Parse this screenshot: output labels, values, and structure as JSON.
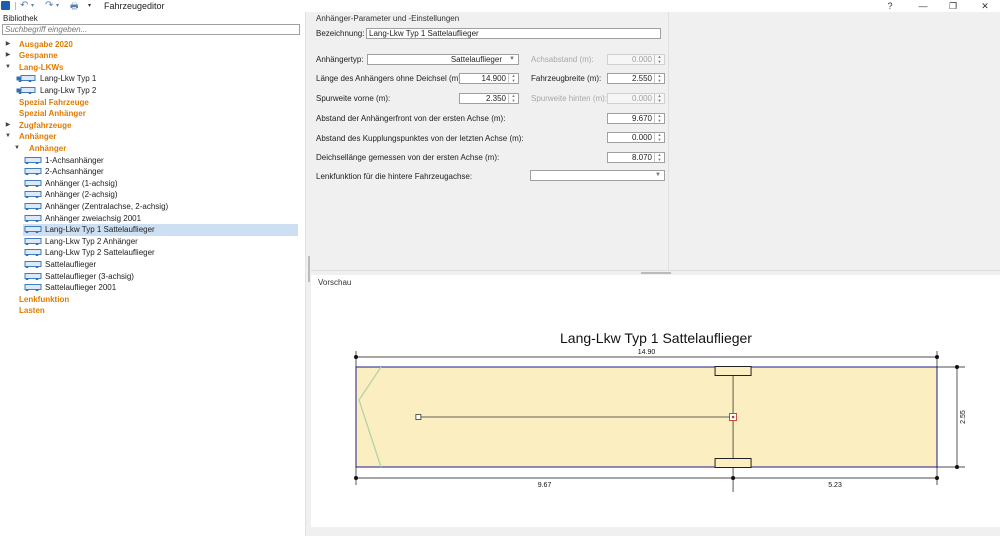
{
  "window": {
    "title": "Fahrzeugeditor",
    "help": "?",
    "minimize": "—",
    "maximize": "❐",
    "close": "✕"
  },
  "quick_access": {
    "undo_icon": "↶",
    "redo_icon": "↷",
    "print_icon": "🖶",
    "dropdown_icon": "▾"
  },
  "library": {
    "header": "Bibliothek",
    "search_placeholder": "Suchbegriff eingeben...",
    "tree": [
      {
        "label": "Ausgabe 2020",
        "kind": "cat",
        "level": 0,
        "expanded": false,
        "icon": ""
      },
      {
        "label": "Gespanne",
        "kind": "cat",
        "level": 0,
        "expanded": false,
        "icon": ""
      },
      {
        "label": "Lang-LKWs",
        "kind": "cat",
        "level": 0,
        "expanded": true,
        "icon": ""
      },
      {
        "label": "Lang-Lkw Typ 1",
        "kind": "leaf",
        "level": 1,
        "icon": "truck-trailer-icon"
      },
      {
        "label": "Lang-Lkw Typ 2",
        "kind": "leaf",
        "level": 1,
        "icon": "truck-trailer-icon"
      },
      {
        "label": "Spezial Fahrzeuge",
        "kind": "cat",
        "level": 0,
        "noarrow": true,
        "icon": ""
      },
      {
        "label": "Spezial Anhänger",
        "kind": "cat",
        "level": 0,
        "noarrow": true,
        "icon": ""
      },
      {
        "label": "Zugfahrzeuge",
        "kind": "cat",
        "level": 0,
        "expanded": false,
        "icon": ""
      },
      {
        "label": "Anhänger",
        "kind": "cat",
        "level": 0,
        "expanded": true,
        "icon": ""
      },
      {
        "label": "Anhänger",
        "kind": "cat",
        "level": 1,
        "expanded": true,
        "icon": ""
      },
      {
        "label": "1-Achsanhänger",
        "kind": "leaf",
        "level": 2,
        "icon": "trailer-icon"
      },
      {
        "label": "2-Achsanhänger",
        "kind": "leaf",
        "level": 2,
        "icon": "trailer-icon"
      },
      {
        "label": "Anhänger (1-achsig)",
        "kind": "leaf",
        "level": 2,
        "icon": "trailer-icon"
      },
      {
        "label": "Anhänger (2-achsig)",
        "kind": "leaf",
        "level": 2,
        "icon": "trailer-icon"
      },
      {
        "label": "Anhänger (Zentralachse, 2-achsig)",
        "kind": "leaf",
        "level": 2,
        "icon": "trailer-icon"
      },
      {
        "label": "Anhänger zweiachsig 2001",
        "kind": "leaf",
        "level": 2,
        "icon": "trailer-icon"
      },
      {
        "label": "Lang-Lkw Typ 1 Sattelauflieger",
        "kind": "leaf",
        "level": 2,
        "icon": "trailer-icon",
        "selected": true
      },
      {
        "label": "Lang-Lkw Typ 2 Anhänger",
        "kind": "leaf",
        "level": 2,
        "icon": "trailer-icon"
      },
      {
        "label": "Lang-Lkw Typ 2 Sattelauflieger",
        "kind": "leaf",
        "level": 2,
        "icon": "trailer-icon"
      },
      {
        "label": "Sattelauflieger",
        "kind": "leaf",
        "level": 2,
        "icon": "trailer-icon"
      },
      {
        "label": "Sattelauflieger (3-achsig)",
        "kind": "leaf",
        "level": 2,
        "icon": "trailer-icon"
      },
      {
        "label": "Sattelauflieger 2001",
        "kind": "leaf",
        "level": 2,
        "icon": "trailer-icon"
      },
      {
        "label": "Lenkfunktion",
        "kind": "cat",
        "level": 0,
        "noarrow": true,
        "icon": ""
      },
      {
        "label": "Lasten",
        "kind": "cat",
        "level": 0,
        "noarrow": true,
        "icon": ""
      }
    ]
  },
  "params": {
    "title": "Anhänger-Parameter und -Einstellungen",
    "bezeichnung_label": "Bezeichnung:",
    "bezeichnung_value": "Lang-Lkw Typ 1 Sattelauflieger",
    "anhaengertyp_label": "Anhängertyp:",
    "anhaengertyp_value": "Sattelauflieger",
    "achsabstand_label": "Achsabstand (m):",
    "achsabstand_value": "0.000",
    "laenge_label": "Länge des Anhängers ohne Deichsel (m):",
    "laenge_value": "14.900",
    "fahrzeugbreite_label": "Fahrzeugbreite (m):",
    "fahrzeugbreite_value": "2.550",
    "spurweite_vorne_label": "Spurweite vorne (m):",
    "spurweite_vorne_value": "2.350",
    "spurweite_hinten_label": "Spurweite hinten (m):",
    "spurweite_hinten_value": "0.000",
    "abstand_front_label": "Abstand der Anhängerfront von der ersten Achse (m):",
    "abstand_front_value": "9.670",
    "abstand_kupplung_label": "Abstand des Kupplungspunktes von der letzten Achse (m):",
    "abstand_kupplung_value": "0.000",
    "deichsel_label": "Deichsellänge gemessen von der ersten Achse (m):",
    "deichsel_value": "8.070",
    "lenkfunktion_label": "Lenkfunktion für die hintere Fahrzeugachse:",
    "lenkfunktion_value": ""
  },
  "preview": {
    "header": "Vorschau",
    "title": "Lang-Lkw Typ 1 Sattelauflieger",
    "length_label": "14.90",
    "width_label": "2.55",
    "front_to_axle_label": "9.67",
    "axle_to_rear_label": "5.23",
    "length_m": 14.9,
    "width_m": 2.55,
    "front_to_axle_m": 9.67,
    "drawbar_m": 8.07,
    "body_color": "#fbeec0",
    "outline_color": "#1a1a8c"
  }
}
